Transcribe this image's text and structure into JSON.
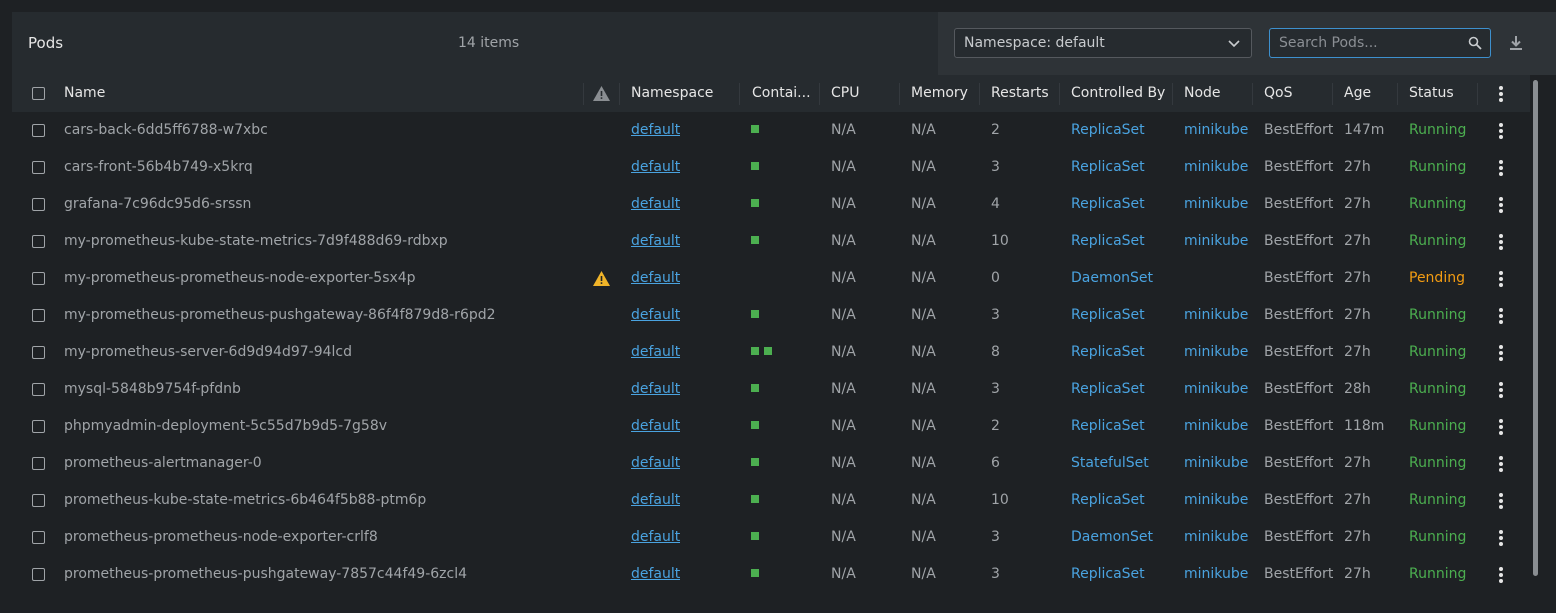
{
  "header": {
    "title": "Pods",
    "count": "14 items",
    "namespace_select": "Namespace: default",
    "search_placeholder": "Search Pods..."
  },
  "columns": [
    "Name",
    "Namespace",
    "Contai...",
    "CPU",
    "Memory",
    "Restarts",
    "Controlled By",
    "Node",
    "QoS",
    "Age",
    "Status"
  ],
  "colors": {
    "link": "#4aa3e0",
    "running": "#4caf50",
    "pending": "#f39c12",
    "container": "#4caf50"
  },
  "rows": [
    {
      "name": "cars-back-6dd5ff6788-w7xbc",
      "warning": false,
      "namespace": "default",
      "containers": 1,
      "cpu": "N/A",
      "memory": "N/A",
      "restarts": "2",
      "controlled_by": "ReplicaSet",
      "node": "minikube",
      "qos": "BestEffort",
      "age": "147m",
      "status": "Running"
    },
    {
      "name": "cars-front-56b4b749-x5krq",
      "warning": false,
      "namespace": "default",
      "containers": 1,
      "cpu": "N/A",
      "memory": "N/A",
      "restarts": "3",
      "controlled_by": "ReplicaSet",
      "node": "minikube",
      "qos": "BestEffort",
      "age": "27h",
      "status": "Running"
    },
    {
      "name": "grafana-7c96dc95d6-srssn",
      "warning": false,
      "namespace": "default",
      "containers": 1,
      "cpu": "N/A",
      "memory": "N/A",
      "restarts": "4",
      "controlled_by": "ReplicaSet",
      "node": "minikube",
      "qos": "BestEffort",
      "age": "27h",
      "status": "Running"
    },
    {
      "name": "my-prometheus-kube-state-metrics-7d9f488d69-rdbxp",
      "warning": false,
      "namespace": "default",
      "containers": 1,
      "cpu": "N/A",
      "memory": "N/A",
      "restarts": "10",
      "controlled_by": "ReplicaSet",
      "node": "minikube",
      "qos": "BestEffort",
      "age": "27h",
      "status": "Running"
    },
    {
      "name": "my-prometheus-prometheus-node-exporter-5sx4p",
      "warning": true,
      "namespace": "default",
      "containers": 0,
      "cpu": "N/A",
      "memory": "N/A",
      "restarts": "0",
      "controlled_by": "DaemonSet",
      "node": "",
      "qos": "BestEffort",
      "age": "27h",
      "status": "Pending"
    },
    {
      "name": "my-prometheus-prometheus-pushgateway-86f4f879d8-r6pd2",
      "warning": false,
      "namespace": "default",
      "containers": 1,
      "cpu": "N/A",
      "memory": "N/A",
      "restarts": "3",
      "controlled_by": "ReplicaSet",
      "node": "minikube",
      "qos": "BestEffort",
      "age": "27h",
      "status": "Running"
    },
    {
      "name": "my-prometheus-server-6d9d94d97-94lcd",
      "warning": false,
      "namespace": "default",
      "containers": 2,
      "cpu": "N/A",
      "memory": "N/A",
      "restarts": "8",
      "controlled_by": "ReplicaSet",
      "node": "minikube",
      "qos": "BestEffort",
      "age": "27h",
      "status": "Running"
    },
    {
      "name": "mysql-5848b9754f-pfdnb",
      "warning": false,
      "namespace": "default",
      "containers": 1,
      "cpu": "N/A",
      "memory": "N/A",
      "restarts": "3",
      "controlled_by": "ReplicaSet",
      "node": "minikube",
      "qos": "BestEffort",
      "age": "28h",
      "status": "Running"
    },
    {
      "name": "phpmyadmin-deployment-5c55d7b9d5-7g58v",
      "warning": false,
      "namespace": "default",
      "containers": 1,
      "cpu": "N/A",
      "memory": "N/A",
      "restarts": "2",
      "controlled_by": "ReplicaSet",
      "node": "minikube",
      "qos": "BestEffort",
      "age": "118m",
      "status": "Running"
    },
    {
      "name": "prometheus-alertmanager-0",
      "warning": false,
      "namespace": "default",
      "containers": 1,
      "cpu": "N/A",
      "memory": "N/A",
      "restarts": "6",
      "controlled_by": "StatefulSet",
      "node": "minikube",
      "qos": "BestEffort",
      "age": "27h",
      "status": "Running"
    },
    {
      "name": "prometheus-kube-state-metrics-6b464f5b88-ptm6p",
      "warning": false,
      "namespace": "default",
      "containers": 1,
      "cpu": "N/A",
      "memory": "N/A",
      "restarts": "10",
      "controlled_by": "ReplicaSet",
      "node": "minikube",
      "qos": "BestEffort",
      "age": "27h",
      "status": "Running"
    },
    {
      "name": "prometheus-prometheus-node-exporter-crlf8",
      "warning": false,
      "namespace": "default",
      "containers": 1,
      "cpu": "N/A",
      "memory": "N/A",
      "restarts": "3",
      "controlled_by": "DaemonSet",
      "node": "minikube",
      "qos": "BestEffort",
      "age": "27h",
      "status": "Running"
    },
    {
      "name": "prometheus-prometheus-pushgateway-7857c44f49-6zcl4",
      "warning": false,
      "namespace": "default",
      "containers": 1,
      "cpu": "N/A",
      "memory": "N/A",
      "restarts": "3",
      "controlled_by": "ReplicaSet",
      "node": "minikube",
      "qos": "BestEffort",
      "age": "27h",
      "status": "Running"
    }
  ]
}
